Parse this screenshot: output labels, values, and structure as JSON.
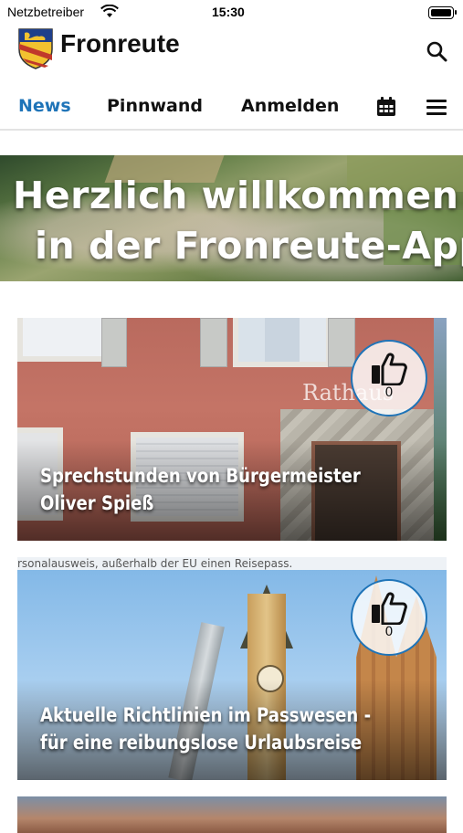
{
  "status_bar": {
    "carrier": "Netzbetreiber",
    "time": "15:30",
    "wifi_icon": "wifi-icon",
    "battery_icon": "battery-icon"
  },
  "header": {
    "app_title": "Fronreute",
    "crest_icon": "coat-of-arms-icon",
    "search_icon": "search-icon"
  },
  "nav": {
    "tabs": [
      {
        "label": "News",
        "active": true
      },
      {
        "label": "Pinnwand",
        "active": false
      },
      {
        "label": "Anmelden",
        "active": false
      }
    ],
    "calendar_icon": "calendar-icon",
    "menu_icon": "hamburger-menu-icon",
    "accent_color": "#1f74b8"
  },
  "banner": {
    "line1": "Herzlich willkommen",
    "line2": "in der Fronreute-App!"
  },
  "news": [
    {
      "title": "Sprechstunden von Bürgermeister Oliver Spieß",
      "image_sign": "Rathaus",
      "likes": "0"
    },
    {
      "title": "Aktuelle Richtlinien im Passwesen - für eine reibungslose Urlaubsreise",
      "image_caption": "rsonalausweis, außerhalb der EU einen Reisepass.",
      "likes": "0"
    }
  ]
}
